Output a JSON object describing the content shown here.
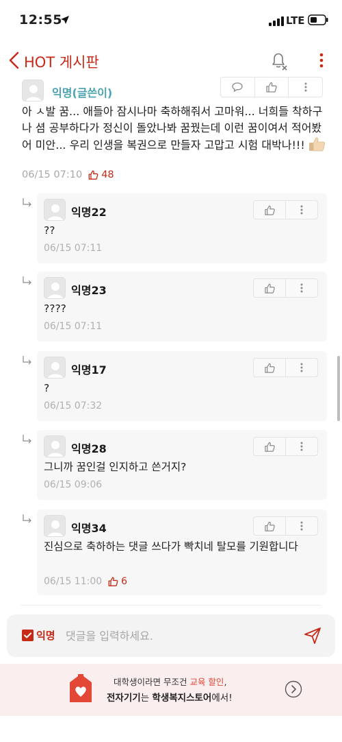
{
  "status_bar": {
    "time": "12:55",
    "network": "LTE"
  },
  "header": {
    "title": "HOT 게시판"
  },
  "post": {
    "author": "익명(글쓴이)",
    "body": "아 ㅅ발 꿈... 애들아 잠시나마 축하해줘서 고마워... 너희들 착하구나 셤 공부하다가 정신이 돌았나봐 꿈꿨는데 이런 꿈이여서 적어봤어 미안... 우리 인생을 복권으로 만들자 고맙고 시험 대박나!!!",
    "timestamp": "06/15 07:10",
    "likes": "48"
  },
  "comments": [
    {
      "author": "익명22",
      "text": "??",
      "timestamp": "06/15 07:11",
      "likes": ""
    },
    {
      "author": "익명23",
      "text": "????",
      "timestamp": "06/15 07:11",
      "likes": ""
    },
    {
      "author": "익명17",
      "text": "?",
      "timestamp": "06/15 07:32",
      "likes": ""
    },
    {
      "author": "익명28",
      "text": "그니까 꿈인걸 인지하고 쓴거지?",
      "timestamp": "06/15 09:06",
      "likes": ""
    },
    {
      "author": "익명34",
      "text": "진심으로 축하하는 댓글 쓰다가 빡치네 탈모를 기원합니다",
      "timestamp": "06/15 11:00",
      "likes": "6"
    }
  ],
  "input_bar": {
    "anonymous_label": "익명",
    "placeholder": "댓글을 입력하세요."
  },
  "banner": {
    "line1_prefix": "대학생이라면 무조건 ",
    "line1_highlight": "교육 할인",
    "line1_suffix": ",",
    "line2_a": "전자기기",
    "line2_b": "는 ",
    "line2_c": "학생복지스토어",
    "line2_d": "에서!"
  },
  "colors": {
    "accent": "#c62917",
    "author_teal": "#4aa3b0"
  }
}
